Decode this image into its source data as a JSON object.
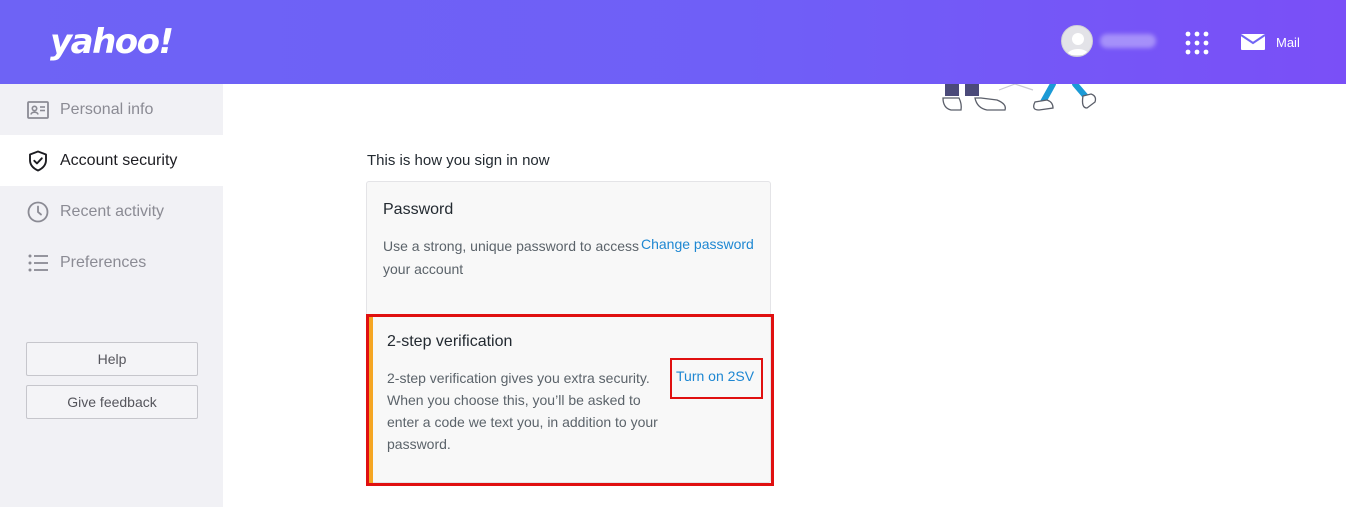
{
  "header": {
    "logo": "yahoo!",
    "username": "",
    "mail_label": "Mail",
    "brand_gradient": [
      "#6e63f5",
      "#7a4ff7"
    ]
  },
  "sidebar": {
    "items": [
      {
        "label": "Personal info",
        "icon": "id-card-icon",
        "active": false
      },
      {
        "label": "Account security",
        "icon": "shield-check-icon",
        "active": true
      },
      {
        "label": "Recent activity",
        "icon": "clock-icon",
        "active": false
      },
      {
        "label": "Preferences",
        "icon": "list-icon",
        "active": false
      }
    ],
    "help_label": "Help",
    "feedback_label": "Give feedback"
  },
  "main": {
    "section_heading": "This is how you sign in now",
    "password": {
      "title": "Password",
      "description": "Use a strong, unique password to access your account",
      "action": "Change password"
    },
    "two_step": {
      "title": "2-step verification",
      "description": "2-step verification gives you extra security. When you choose this, you’ll be asked to enter a code we text you, in addition to your password.",
      "action": "Turn on 2SV",
      "highlight_color": "#e01010",
      "accent_color": "#f5a623"
    },
    "link_color": "#1e87d2"
  }
}
